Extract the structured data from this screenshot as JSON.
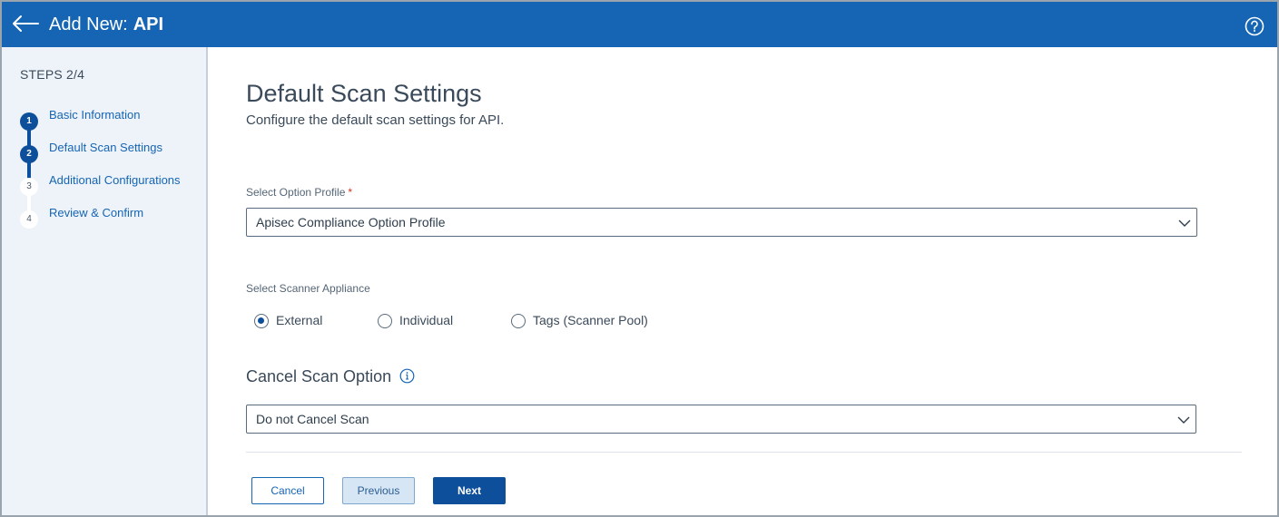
{
  "header": {
    "title_prefix": "Add New:",
    "title_name": "API",
    "back_icon": "arrow-left-icon",
    "help_icon": "question-circle-icon",
    "bg_color": "#1565b4"
  },
  "sidebar": {
    "steps_label": "STEPS 2/4",
    "steps": [
      {
        "number": "1",
        "label": "Basic Information",
        "state": "done"
      },
      {
        "number": "2",
        "label": "Default Scan Settings",
        "state": "current"
      },
      {
        "number": "3",
        "label": "Additional Configurations",
        "state": "todo"
      },
      {
        "number": "4",
        "label": "Review & Confirm",
        "state": "todo"
      }
    ]
  },
  "main": {
    "title": "Default Scan Settings",
    "subtitle": "Configure the default scan settings for API.",
    "option_profile": {
      "label": "Select Option Profile",
      "required_mark": "*",
      "value": "Apisec Compliance Option Profile"
    },
    "scanner_appliance": {
      "label": "Select Scanner Appliance",
      "options": [
        {
          "label": "External",
          "selected": true
        },
        {
          "label": "Individual",
          "selected": false
        },
        {
          "label": "Tags (Scanner Pool)",
          "selected": false
        }
      ]
    },
    "cancel_scan": {
      "title": "Cancel Scan Option",
      "info_icon": "info-circle-icon",
      "value": "Do not Cancel Scan"
    },
    "buttons": {
      "cancel": "Cancel",
      "previous": "Previous",
      "next": "Next"
    }
  }
}
